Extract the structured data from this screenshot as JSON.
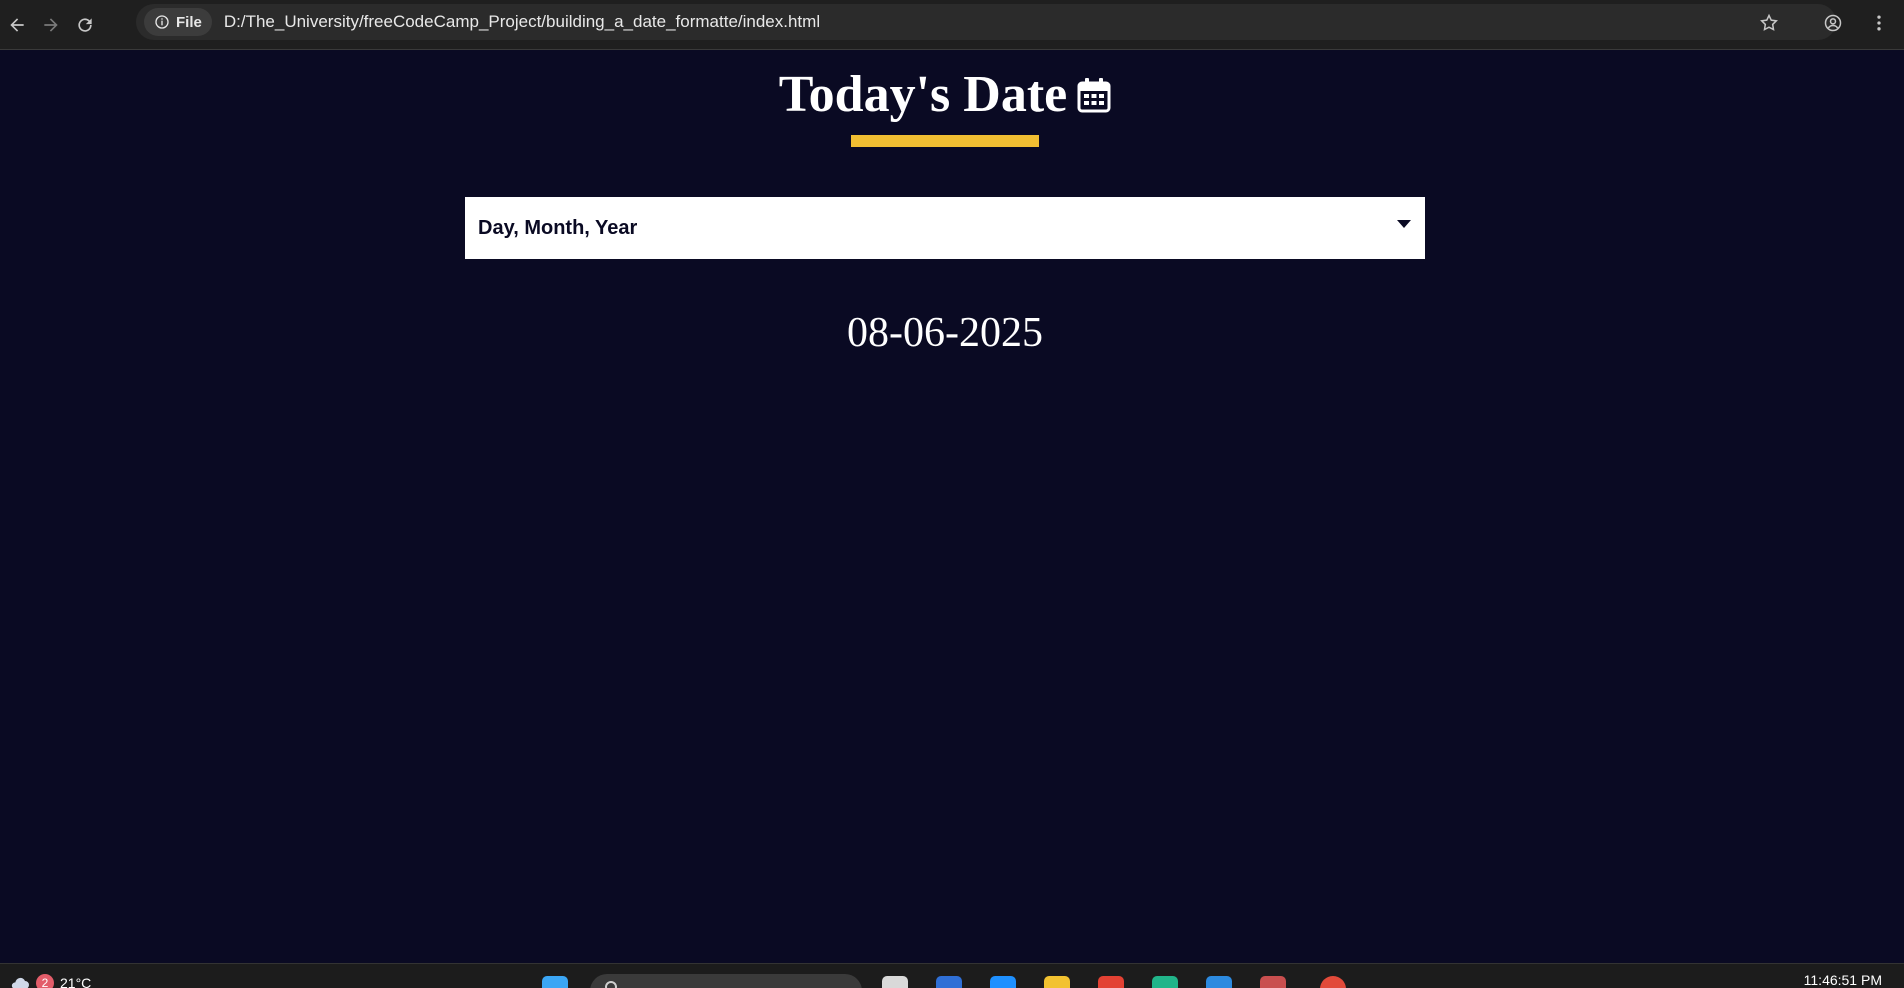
{
  "browser": {
    "chip_label": "File",
    "url": "D:/The_University/freeCodeCamp_Project/building_a_date_formatte/index.html"
  },
  "page": {
    "title": "Today's Date",
    "format_select": {
      "selected": "Day, Month, Year"
    },
    "current_date": "08-06-2025"
  },
  "taskbar": {
    "weather_temp": "21°C",
    "weather_badge": "2",
    "clock": "11:46:51 PM"
  },
  "colors": {
    "background": "#0a0a23",
    "accent": "#f1be32",
    "text": "#ffffff"
  }
}
